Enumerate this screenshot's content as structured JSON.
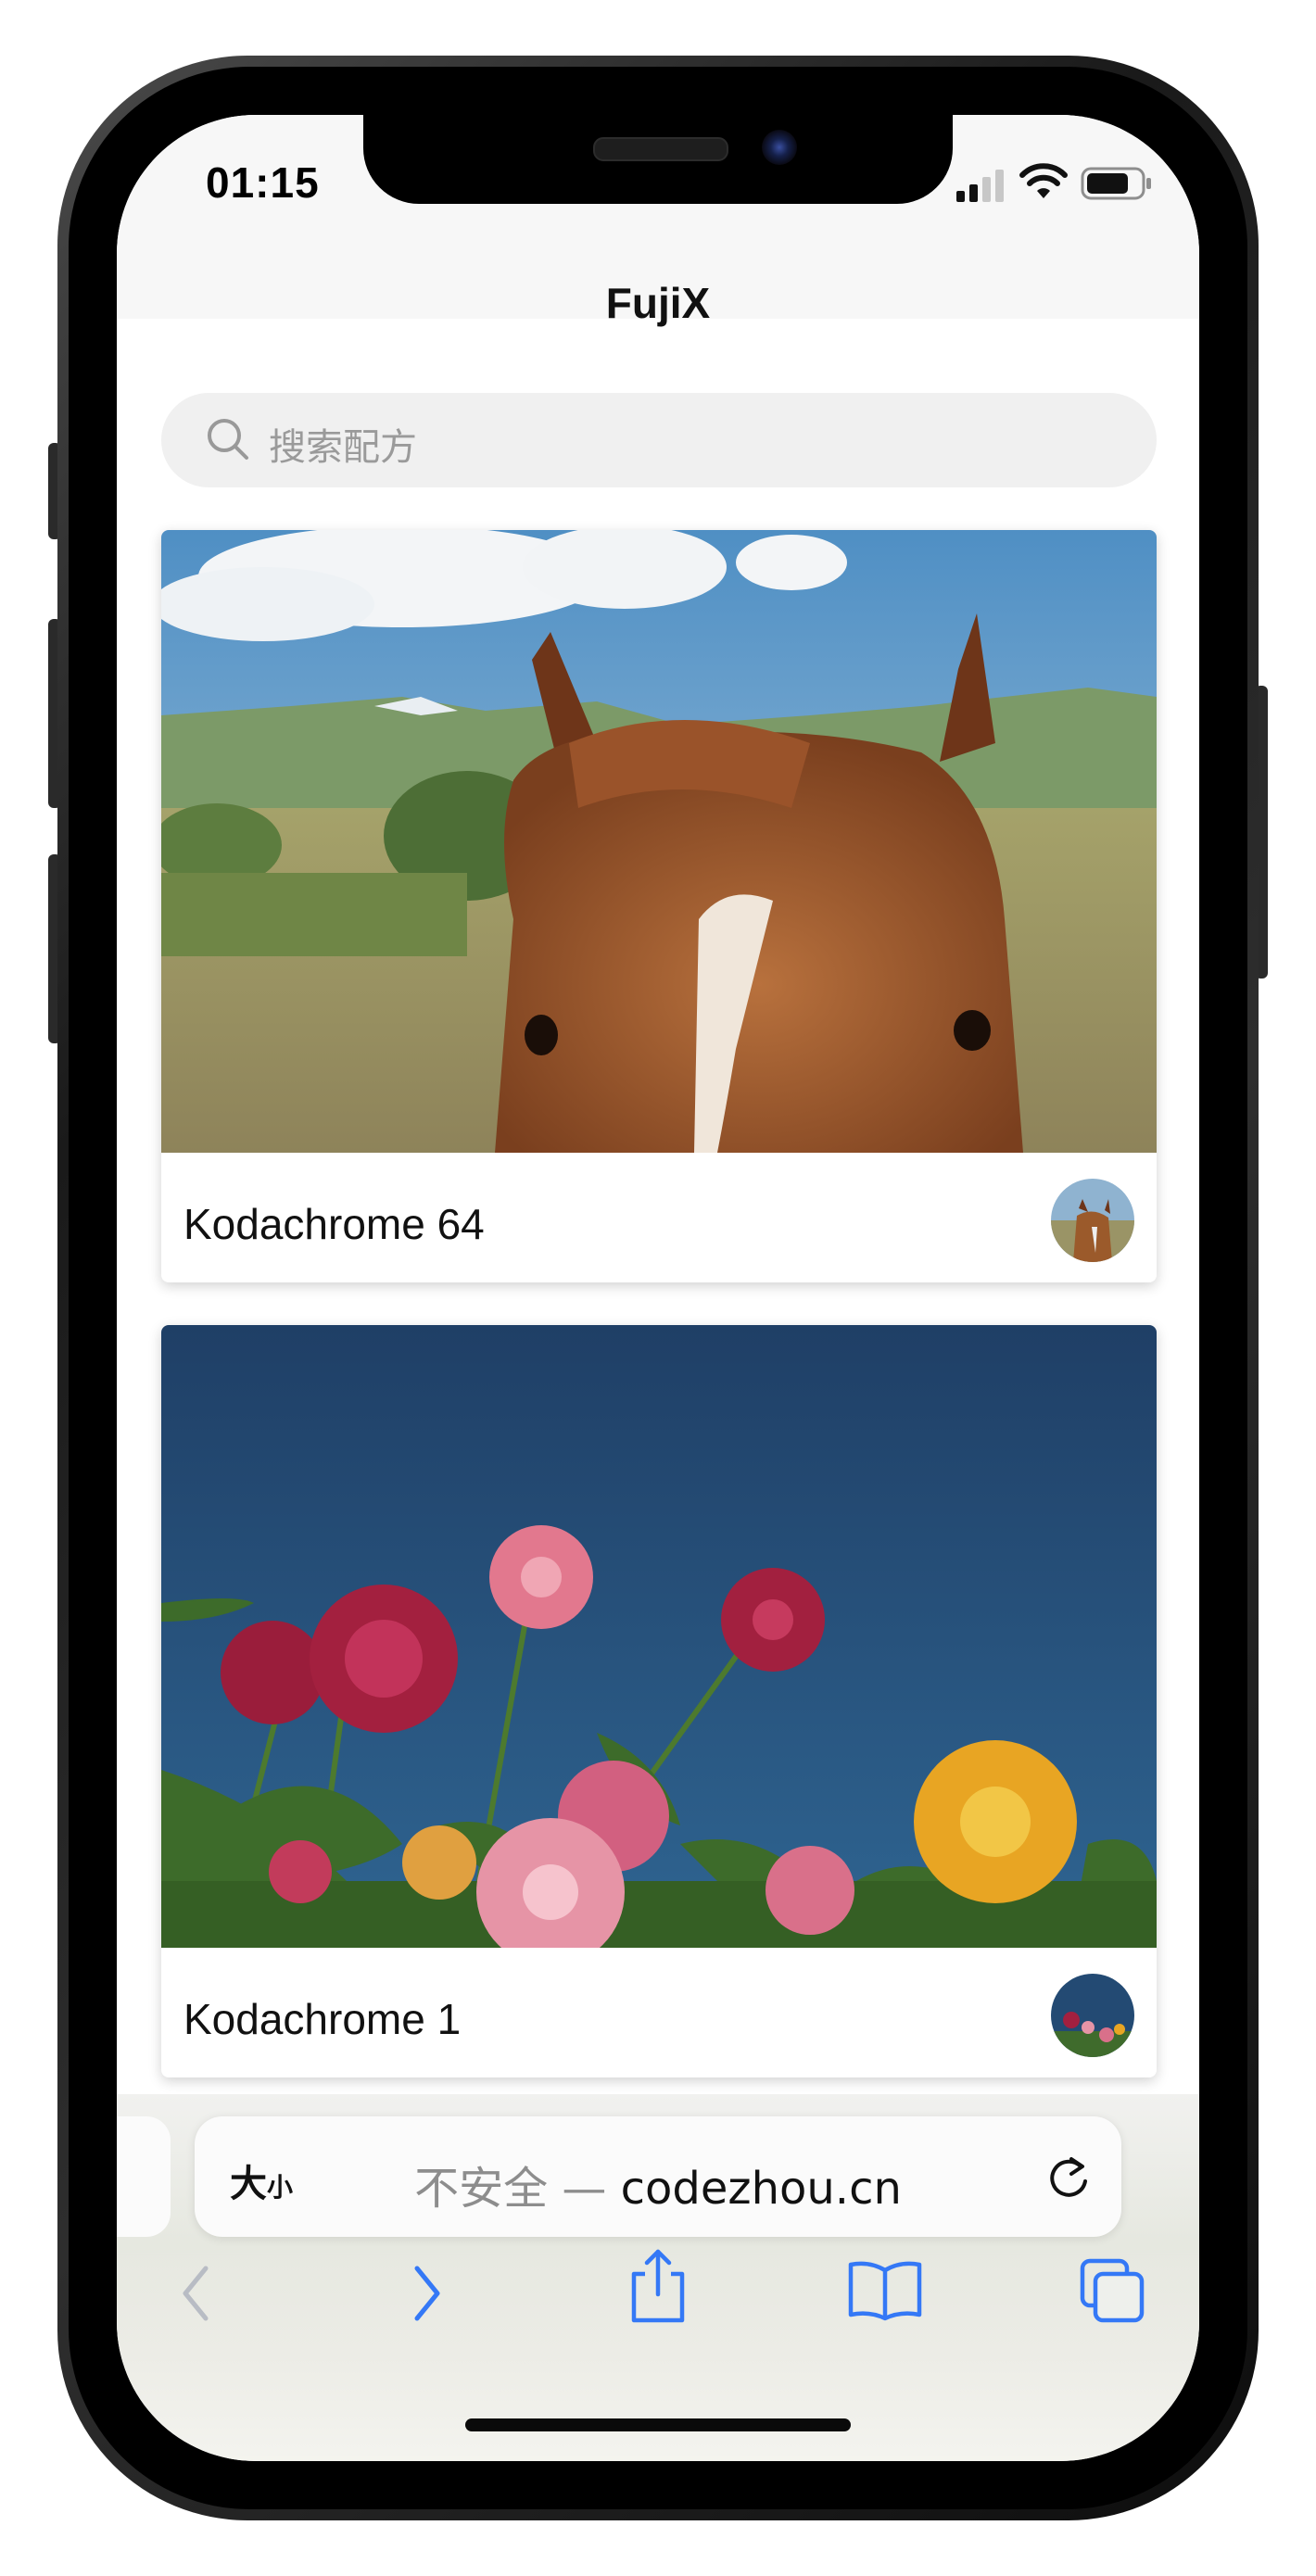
{
  "status_bar": {
    "time": "01:15",
    "signal_icon": "signal-bars-icon",
    "wifi_icon": "wifi-icon",
    "battery_icon": "battery-icon"
  },
  "header": {
    "title": "FujiX"
  },
  "search": {
    "placeholder": "搜索配方",
    "icon": "search-icon"
  },
  "recipes": [
    {
      "name": "Kodachrome 64"
    },
    {
      "name": "Kodachrome 1"
    }
  ],
  "safari": {
    "text_size_label": "大",
    "text_size_label_small": "小",
    "url_prefix": "不安全 — ",
    "url_domain": "codezhou.cn",
    "reload_icon": "reload-icon",
    "back_icon": "chevron-left-icon",
    "forward_icon": "chevron-right-icon",
    "share_icon": "share-icon",
    "bookmarks_icon": "book-icon",
    "tabs_icon": "tabs-icon"
  },
  "colors": {
    "accent": "#3478f6",
    "disabled": "#b8bcc4"
  }
}
